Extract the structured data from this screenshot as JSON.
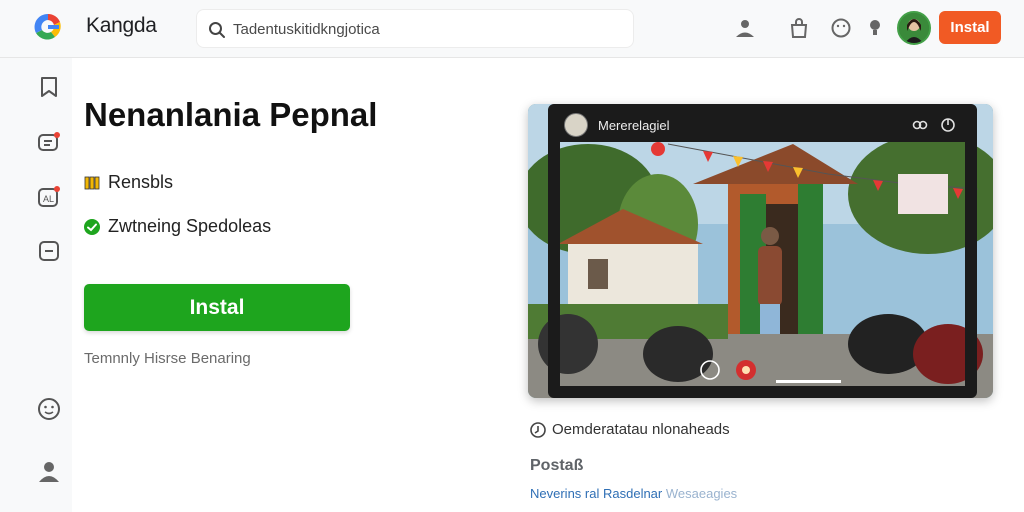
{
  "header": {
    "brand": "Kangda",
    "search_placeholder": "Tadentuskitidkngjotica",
    "install_label": "Instal",
    "icons": [
      "user-icon",
      "bag-icon",
      "smile-icon",
      "bulb-icon"
    ],
    "accent": "#f15a24"
  },
  "rail": {
    "icons": [
      "bookmark-icon",
      "chat-icon",
      "library-icon",
      "square-icon",
      "emoji-icon",
      "profile-icon"
    ]
  },
  "main": {
    "title": "Nenanlania Pepnal",
    "feature_1": "Rensbls",
    "feature_2": "Zwtneing Spedoleas",
    "install_label": "Instal",
    "terms": "Temnnly Hisrse Benaring",
    "install_color": "#1ea51e"
  },
  "media": {
    "channel": "Mererelagiel",
    "caption": "Oemderatatau nlonaheads"
  },
  "section": {
    "heading": "Postaß",
    "link_1": "Neverins ral",
    "link_2": "Rasdelnar",
    "link_3": "Wesaeagies"
  }
}
